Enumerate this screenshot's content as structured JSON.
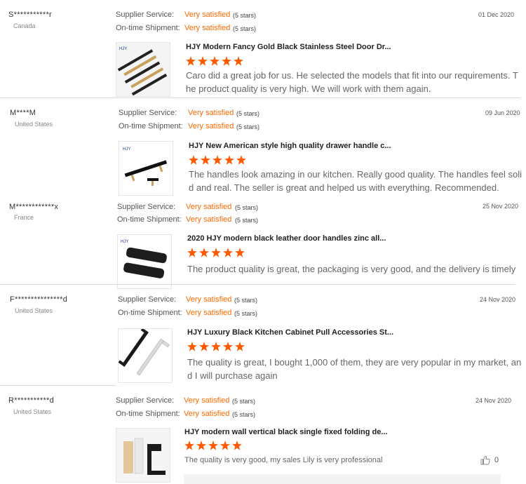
{
  "labels": {
    "supplier_service": "Supplier Service:",
    "ontime_shipment": "On-time Shipment:"
  },
  "reviews": [
    {
      "buyer": "S***********r",
      "country": "Canada",
      "date": "01 Dec 2020",
      "supplier_service": "Very satisfied",
      "supplier_stars": "(5 stars)",
      "ontime_shipment": "Very satisfied",
      "ontime_stars": "(5 stars)",
      "product_title": "HJY Modern Fancy Gold Black Stainless Steel Door Dr...",
      "rating": 5,
      "comment": "Caro did a great job for us. He selected the models that fit into our requirements. The product quality is very high. We will work with them again."
    },
    {
      "buyer": "M****M",
      "country": "United States",
      "date": "09 Jun 2020",
      "supplier_service": "Very satisfied",
      "supplier_stars": "(5 stars)",
      "ontime_shipment": "Very satisfied",
      "ontime_stars": "(5 stars)",
      "product_title": "HJY New American style high quality drawer handle c...",
      "rating": 5,
      "comment": "The handles look amazing in our kitchen. Really good quality. The handles feel solid and real. The seller is great and helped us with everything. Recommended."
    },
    {
      "buyer": "M************x",
      "country": "France",
      "date": "25 Nov 2020",
      "supplier_service": "Very satisfied",
      "supplier_stars": "(5 stars)",
      "ontime_shipment": "Very satisfied",
      "ontime_stars": "(5 stars)",
      "product_title": "2020 HJY modern black leather door handles zinc all...",
      "rating": 5,
      "comment": "The product quality is great, the packaging is very good, and the delivery is timely"
    },
    {
      "buyer": "F***************d",
      "country": "United States",
      "date": "24 Nov 2020",
      "supplier_service": "Very satisfied",
      "supplier_stars": "(5 stars)",
      "ontime_shipment": "Very satisfied",
      "ontime_stars": "(5 stars)",
      "product_title": "HJY Luxury Black Kitchen Cabinet Pull Accessories St...",
      "rating": 5,
      "comment": "The quality is great, I bought 1,000 of them, they are very popular in my market, and I will purchase again"
    },
    {
      "buyer": "R***********d",
      "country": "United States",
      "date": "24 Nov 2020",
      "supplier_service": "Very satisfied",
      "supplier_stars": "(5 stars)",
      "ontime_shipment": "Very satisfied",
      "ontime_stars": "(5 stars)",
      "product_title": "HJY modern wall vertical black single fixed folding de...",
      "rating": 5,
      "comment": "The quality is very good, my sales Lily is very professional",
      "likes": "0"
    }
  ],
  "icons": {
    "thumbs_up": "thumbs-up-icon",
    "star": "star-icon"
  },
  "colors": {
    "accent": "#ff6a00",
    "star": "#ff5a00"
  }
}
